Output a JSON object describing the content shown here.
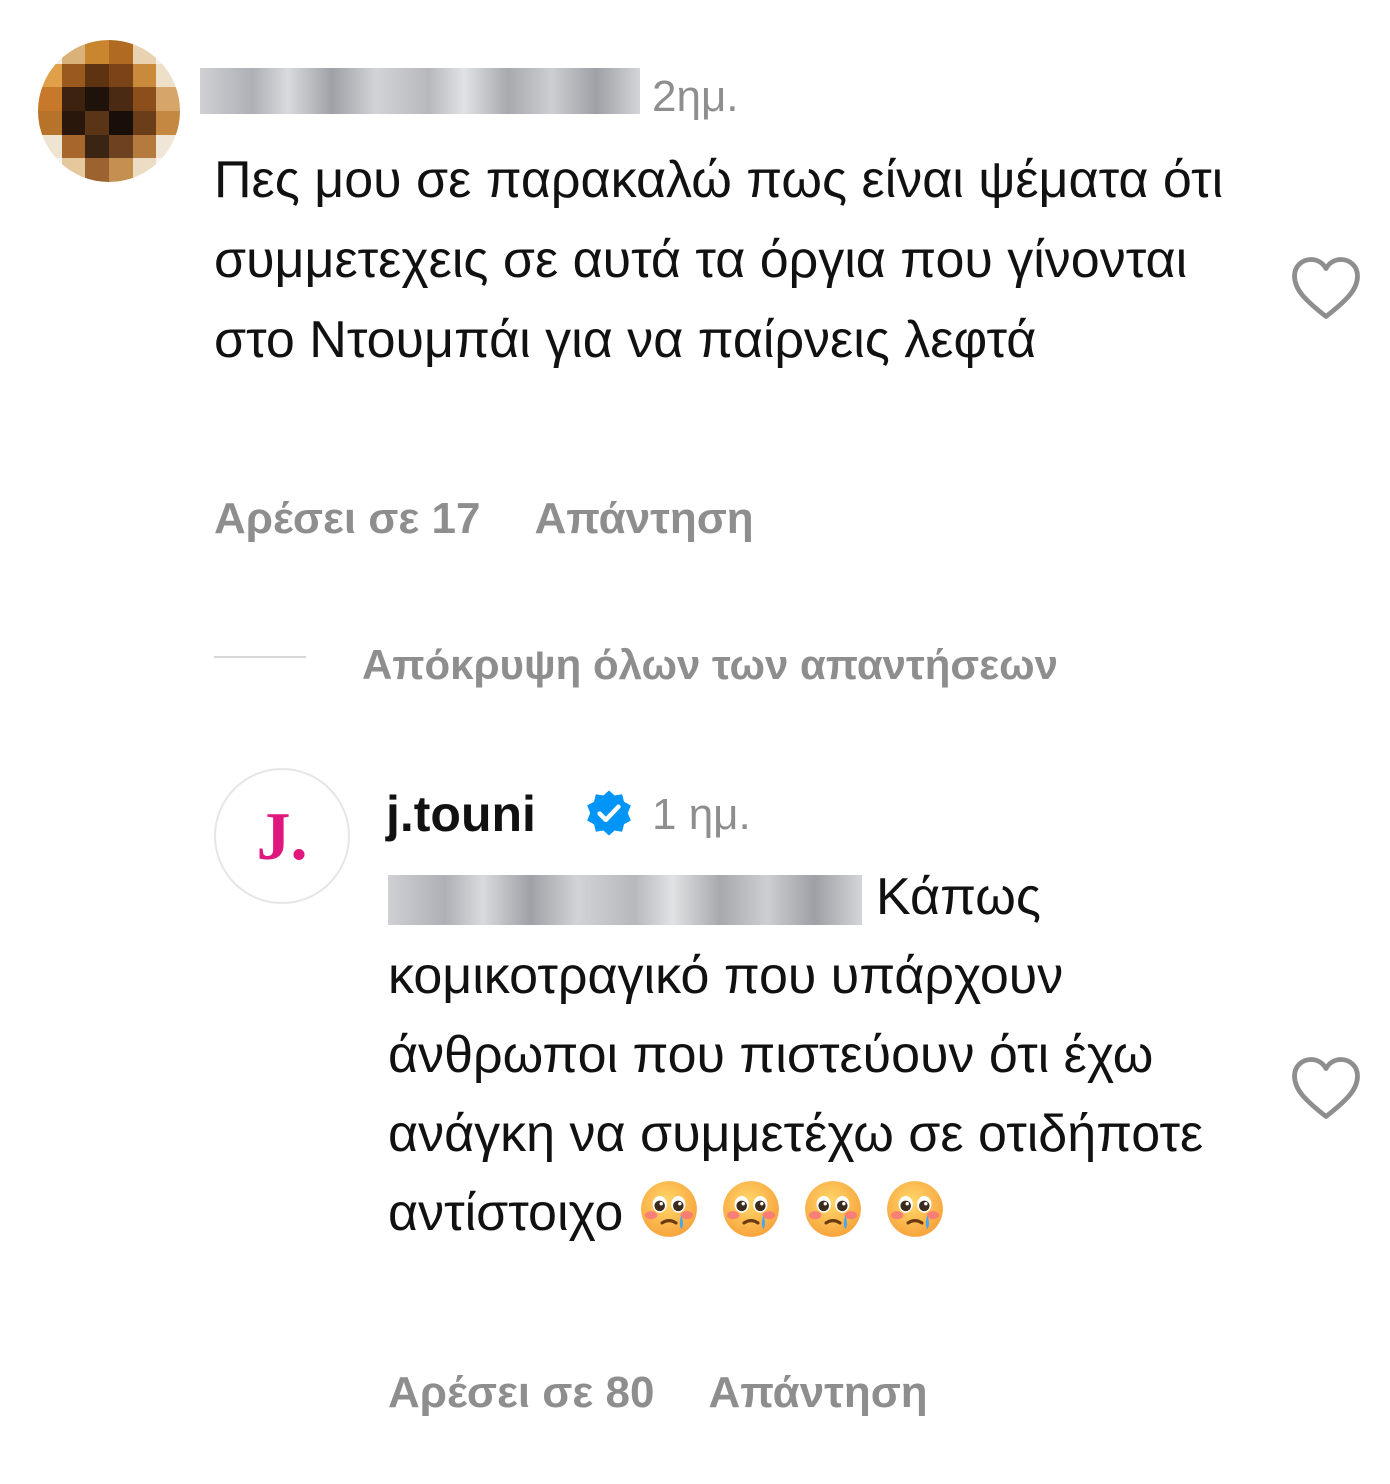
{
  "comment": {
    "time": "2ημ.",
    "text": "Πες μου σε παρακαλώ πως είναι ψέματα ότι συμμετεχεις σε αυτά τα όργια που γίνονται στο Ντουμπάι για να παίρνεις λεφτά",
    "likes_label": "Αρέσει σε 17",
    "reply_label": "Απάντηση",
    "like_icon": "heart-outline-icon"
  },
  "hide_replies_label": "Απόκρυψη όλων των απαντήσεων",
  "reply": {
    "avatar_letter": "J.",
    "username": "j.touni",
    "verified_icon": "verified-badge-icon",
    "time": "1 ημ.",
    "text": "Κάπως κομικοτραγικό που υπάρχουν άνθρωποι που πιστεύουν ότι έχω ανάγκη να συμμετέχω σε οτιδήποτε αντίστοιχο",
    "emoji_name": "face-holding-back-tears-emoji",
    "likes_label": "Αρέσει σε 80",
    "reply_label": "Απάντηση",
    "like_icon": "heart-outline-icon"
  },
  "colors": {
    "secondary_text": "#8e8e8e",
    "verified_blue": "#0095f6",
    "brand_pink": "#e0177d"
  }
}
